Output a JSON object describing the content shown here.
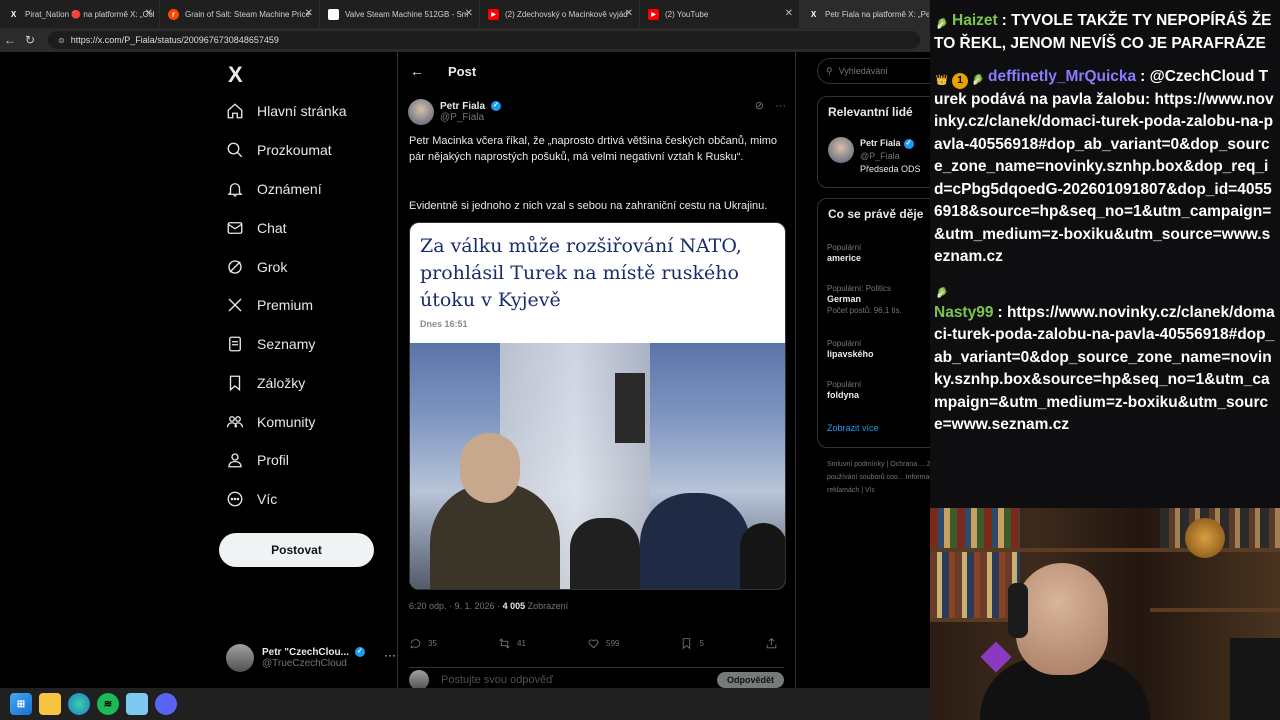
{
  "browser": {
    "tabs": [
      {
        "label": "Pirat_Nation 🔴 na platformě X: „Col",
        "favicon": "X",
        "color": "#000000"
      },
      {
        "label": "Grain of Salt: Steam Machine Price",
        "favicon": "r",
        "color": "#ff4500"
      },
      {
        "label": "Valve Steam Machine 512GB - Sm",
        "favicon": "",
        "color": "#ffffff"
      },
      {
        "label": "(2) Zdechovský o Macinkově vyjád",
        "favicon": "▶",
        "color": "#ff0000"
      },
      {
        "label": "(2) YouTube",
        "favicon": "▶",
        "color": "#ff0000"
      },
      {
        "label": "Petr Fiala na platformě X: „Petr",
        "favicon": "X",
        "color": "#000000"
      }
    ],
    "url": "https://x.com/P_Fiala/status/2009676730848657459"
  },
  "nav": {
    "logo": "X",
    "items": [
      {
        "label": "Hlavní stránka",
        "icon": "home-icon"
      },
      {
        "label": "Prozkoumat",
        "icon": "search-icon"
      },
      {
        "label": "Oznámení",
        "icon": "bell-icon"
      },
      {
        "label": "Chat",
        "icon": "mail-icon"
      },
      {
        "label": "Grok",
        "icon": "grok-icon"
      },
      {
        "label": "Premium",
        "icon": "x-premium-icon"
      },
      {
        "label": "Seznamy",
        "icon": "list-icon"
      },
      {
        "label": "Záložky",
        "icon": "bookmark-icon"
      },
      {
        "label": "Komunity",
        "icon": "community-icon"
      },
      {
        "label": "Profil",
        "icon": "profile-icon"
      },
      {
        "label": "Víc",
        "icon": "more-circle-icon"
      }
    ],
    "post_button": "Postovat",
    "account": {
      "name": "Petr \"CzechClou...",
      "handle": "@TrueCzechCloud"
    }
  },
  "post": {
    "header": "Post",
    "author_name": "Petr Fiala",
    "author_handle": "@P_Fiala",
    "text1": "Petr Macinka včera říkal, že „naprosto drtivá většina českých občanů, mimo pár nějakých naprostých pošuků, má velmi negativní vztah k Rusku“.",
    "text2": "Evidentně si jednoho z nich vzal s sebou na zahraniční cestu na Ukrajinu.",
    "card_headline": "Za válku může rozšiřování NATO, prohlásil Turek na místě ruského útoku v Kyjevě",
    "card_time": "Dnes 16:51",
    "time": "6:20 odp. · 9. 1. 2026 · ",
    "views_count": "4 005",
    "views_label": " Zobrazení",
    "replies": "35",
    "reposts": "41",
    "likes": "599",
    "bookmarks": "5",
    "reply_placeholder": "Postujte svou odpověď",
    "reply_button": "Odpovědět"
  },
  "sidebar": {
    "search_placeholder": "Vyhledávání",
    "relevant_title": "Relevantní lidé",
    "relevant_person": {
      "name": "Petr Fiala",
      "handle": "@P_Fiala",
      "bio": "Předseda ODS"
    },
    "trending_title": "Co se právě děje",
    "trends": [
      {
        "context": "Populární",
        "name": "americe",
        "count": ""
      },
      {
        "context": "Populární: Politics",
        "name": "German",
        "count": "Počet postů: 96,1 tis."
      },
      {
        "context": "Populární",
        "name": "lipavského",
        "count": ""
      },
      {
        "context": "Populární",
        "name": "foldyna",
        "count": ""
      }
    ],
    "show_more": "Zobrazit více",
    "footer": "Smluvní podmínky | Ochrana ... Zásady používání souborů coo... Informace o reklamách | Víc"
  },
  "chat": {
    "messages": [
      {
        "user": "Haizet",
        "color": "#7ac74f",
        "badges": [
          "🥬"
        ],
        "text": "TYVOLE TAKŽE TY NEPOPÍRÁŠ ŽE TO ŘEKL, JENOM NEVÍŠ CO JE PARAFRÁZE"
      },
      {
        "user": "deffinetly_MrQuicka",
        "color": "#8a7cff",
        "badges": [
          "👑",
          "1",
          "🥬"
        ],
        "text": "@CzechCloud Turek podává na pavla žalobu: https://www.novinky.cz/clanek/domaci-turek-poda-zalobu-na-pavla-40556918#dop_ab_variant=0&dop_source_zone_name=novinky.sznhp.box&dop_req_id=cPbg5dqoedG-202601091807&dop_id=40556918&source=hp&seq_no=1&utm_campaign=&utm_medium=z-boxiku&utm_source=www.seznam.cz"
      },
      {
        "user": "Nasty99",
        "color": "#7ac74f",
        "badges": [
          "🥬"
        ],
        "text": "https://www.novinky.cz/clanek/domaci-turek-poda-zalobu-na-pavla-40556918#dop_ab_variant=0&dop_source_zone_name=novinky.sznhp.box&source=hp&seq_no=1&utm_campaign=&utm_medium=z-boxiku&utm_source=www.seznam.cz"
      }
    ]
  },
  "taskbar": {
    "icons": [
      "windows-start-icon",
      "file-explorer-icon",
      "edge-icon",
      "spotify-icon",
      "notepad-icon",
      "discord-icon"
    ]
  }
}
